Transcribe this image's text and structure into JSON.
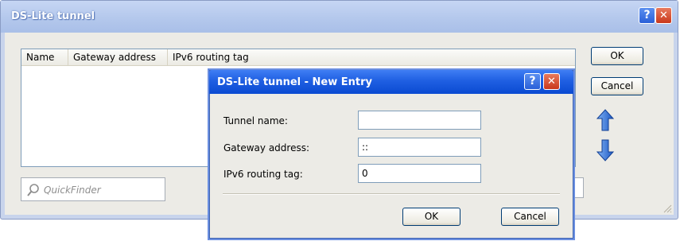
{
  "outer": {
    "title": "DS-Lite tunnel",
    "columns": [
      "Name",
      "Gateway address",
      "IPv6 routing tag"
    ],
    "ok_label": "OK",
    "cancel_label": "Cancel",
    "quickfinder_placeholder": "QuickFinder",
    "help_glyph": "?",
    "close_glyph": "✕"
  },
  "dialog": {
    "title": "DS-Lite tunnel - New Entry",
    "fields": [
      {
        "label": "Tunnel name:",
        "value": ""
      },
      {
        "label": "Gateway address:",
        "value": "::"
      },
      {
        "label": "IPv6 routing tag:",
        "value": "0"
      }
    ],
    "ok_label": "OK",
    "cancel_label": "Cancel",
    "help_glyph": "?",
    "close_glyph": "✕"
  },
  "colors": {
    "inner_titlebar": "#0a4ad2",
    "outer_titlebar": "#b4c8ec",
    "arrow_blue": "#2f6fd0"
  },
  "icons": {
    "move_up": "arrow-up-icon",
    "move_down": "arrow-down-icon",
    "quickfinder": "search-icon"
  }
}
